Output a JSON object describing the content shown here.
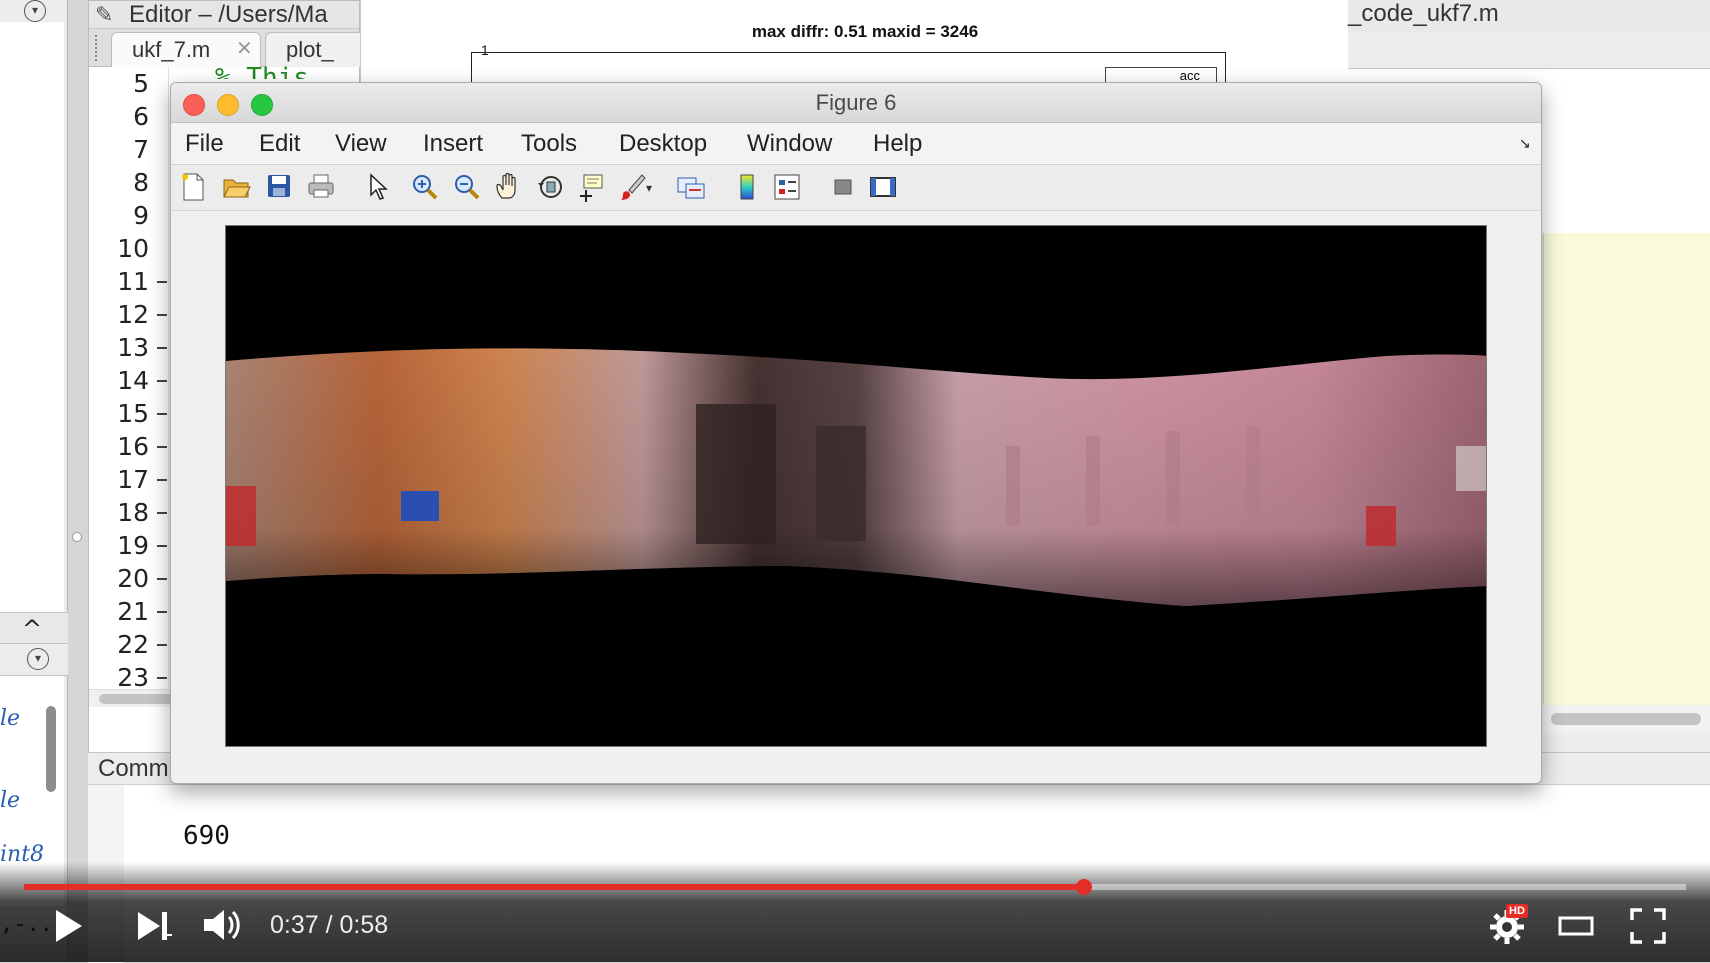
{
  "editor": {
    "title": "Editor – /Users/Ma",
    "tabs": [
      "ukf_7.m",
      "plot_"
    ],
    "tab_close": "✕",
    "code_fragment": "% This",
    "line_numbers": [
      "5",
      "6",
      "7",
      "8",
      "9",
      "10",
      "11",
      "12",
      "13",
      "14",
      "15",
      "16",
      "17",
      "18",
      "19",
      "20",
      "21",
      "22",
      "23"
    ]
  },
  "background_plot": {
    "title": "max diffr: 0.51 maxid = 3246",
    "y_tick": "1",
    "legend_fragment": "acc"
  },
  "right_panel": {
    "title_fragment": "_code_ukf7.m"
  },
  "left_panel": {
    "snippets": [
      "le",
      "le",
      "int8"
    ],
    "bottom_snippet": ",-.."
  },
  "command_window": {
    "title": "Comm",
    "output": "690"
  },
  "figure": {
    "title": "Figure 6",
    "menu": [
      "File",
      "Edit",
      "View",
      "Insert",
      "Tools",
      "Desktop",
      "Window",
      "Help"
    ],
    "toolbar_icons": [
      "new-figure-icon",
      "open-file-icon",
      "save-icon",
      "print-icon",
      "pointer-icon",
      "zoom-in-icon",
      "zoom-out-icon",
      "pan-icon",
      "rotate-3d-icon",
      "data-cursor-icon",
      "brush-icon",
      "brush-dropdown-icon",
      "link-plot-icon",
      "colorbar-icon",
      "legend-icon",
      "hide-plot-tools-icon",
      "show-plot-tools-icon"
    ],
    "image_description_colors": {
      "wall_orange": "#d88a52",
      "wall_pink": "#d79aa8",
      "dark": "#3a2a2a"
    }
  },
  "player": {
    "current_time": "0:37",
    "duration": "0:58",
    "time_separator": " / ",
    "progress_fraction": 0.638,
    "hd_badge": "HD",
    "accent": "#e52d27"
  }
}
